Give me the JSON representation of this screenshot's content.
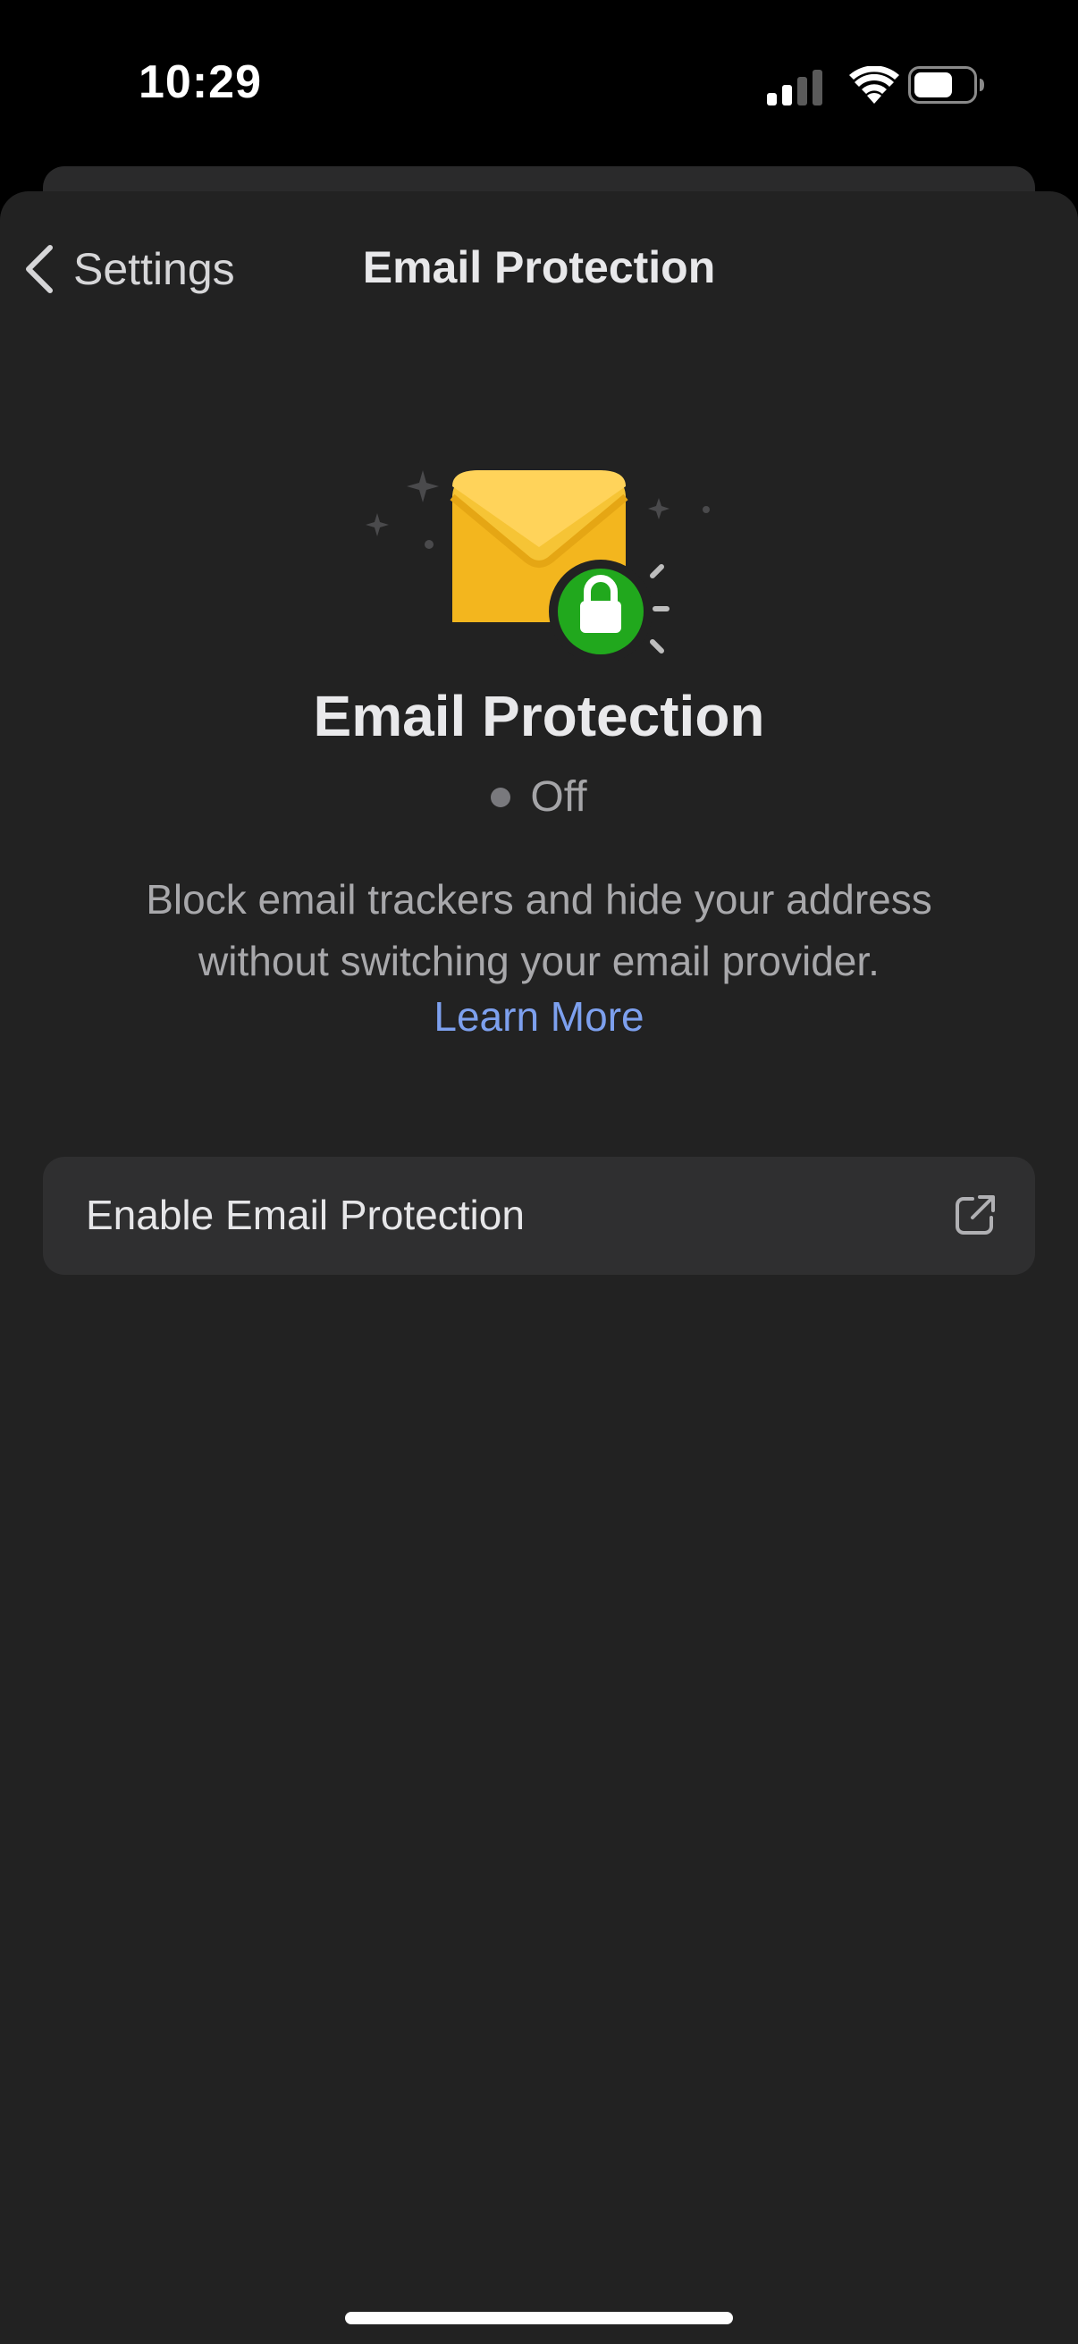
{
  "status_bar": {
    "time": "10:29",
    "icons": [
      "signal-icon",
      "wifi-icon",
      "battery-icon"
    ]
  },
  "nav": {
    "back_label": "Settings",
    "title": "Email Protection"
  },
  "hero": {
    "illustration": "envelope-lock-icon",
    "title": "Email Protection",
    "status": "Off",
    "status_color": "#79797d",
    "description": "Block email trackers and hide your address without switching your email provider.",
    "learn_more": "Learn More",
    "link_color": "#7da0ee"
  },
  "enable_row": {
    "label": "Enable Email Protection",
    "icon": "external-link-icon"
  },
  "colors": {
    "background": "#222222",
    "envelope": "#f6c435",
    "lock_badge": "#21a81d"
  }
}
